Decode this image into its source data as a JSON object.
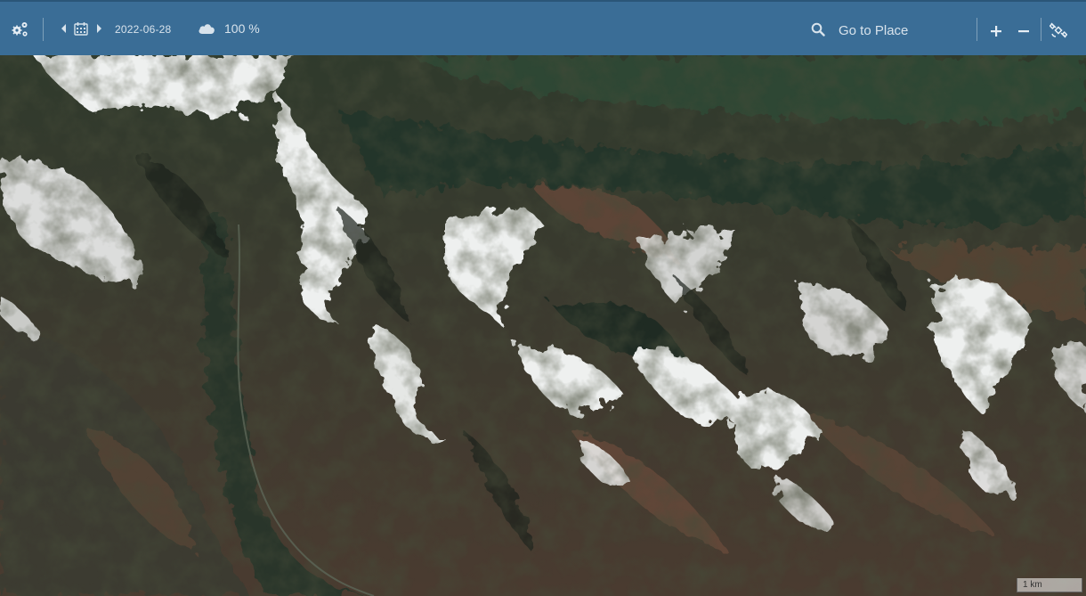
{
  "toolbar": {
    "settings_icon": "gear-icon",
    "date": "2022-06-28",
    "cloud_coverage": "100 %",
    "search": {
      "placeholder": "Go to Place"
    },
    "zoom_in": "+",
    "zoom_out": "−"
  },
  "map": {
    "scale_label": "1 km"
  },
  "colors": {
    "toolbar_bg": "#3a6d96",
    "toolbar_text": "#d8e3ec"
  }
}
